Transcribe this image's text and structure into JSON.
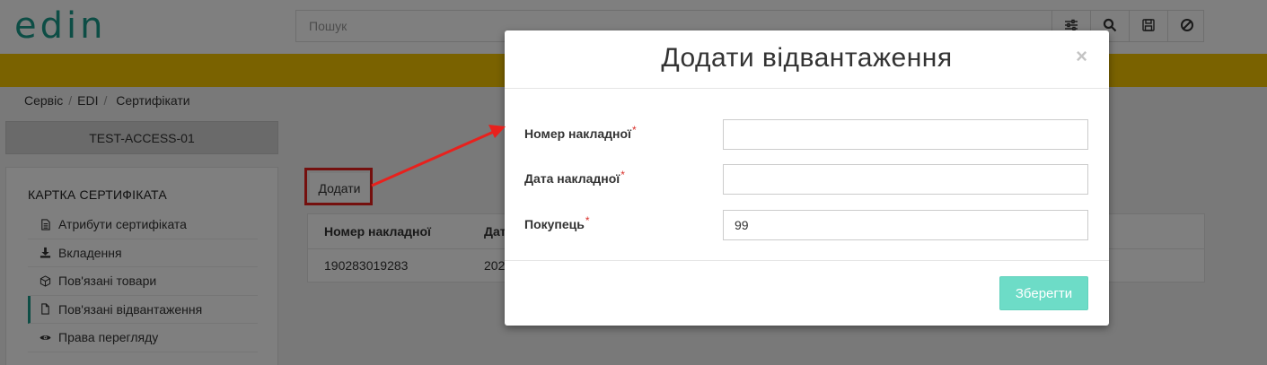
{
  "header": {
    "logo": "edin",
    "search_placeholder": "Пошук"
  },
  "breadcrumb": [
    "Сервіс",
    "EDI",
    "Сертифікати"
  ],
  "entity_button": "TEST-ACCESS-01",
  "sidebar": {
    "title": "Картка сертифіката",
    "items": [
      {
        "label": "Атрибути сертифіката",
        "icon": "file-text-icon"
      },
      {
        "label": "Вкладення",
        "icon": "download-icon"
      },
      {
        "label": "Пов'язані товари",
        "icon": "box-icon"
      },
      {
        "label": "Пов'язані відвантаження",
        "icon": "file-icon"
      },
      {
        "label": "Права перегляду",
        "icon": "eye-icon"
      }
    ]
  },
  "add_button": "Додати",
  "table": {
    "headers": [
      "Номер накладної",
      "Дат"
    ],
    "rows": [
      [
        "190283019283",
        "202"
      ]
    ]
  },
  "modal": {
    "title": "Додати відвантаження",
    "close": "×",
    "fields": [
      {
        "label": "Номер накладної",
        "required": "*",
        "value": ""
      },
      {
        "label": "Дата накладної",
        "required": "*",
        "value": ""
      },
      {
        "label": "Покупець",
        "required": "*",
        "value": "99"
      }
    ],
    "save_button": "Зберегти"
  },
  "colors": {
    "brand": "#1a9a8a",
    "yellow_bar": "#f5c400",
    "save_button": "#6ddcc7",
    "annotation": "#e8211d"
  }
}
